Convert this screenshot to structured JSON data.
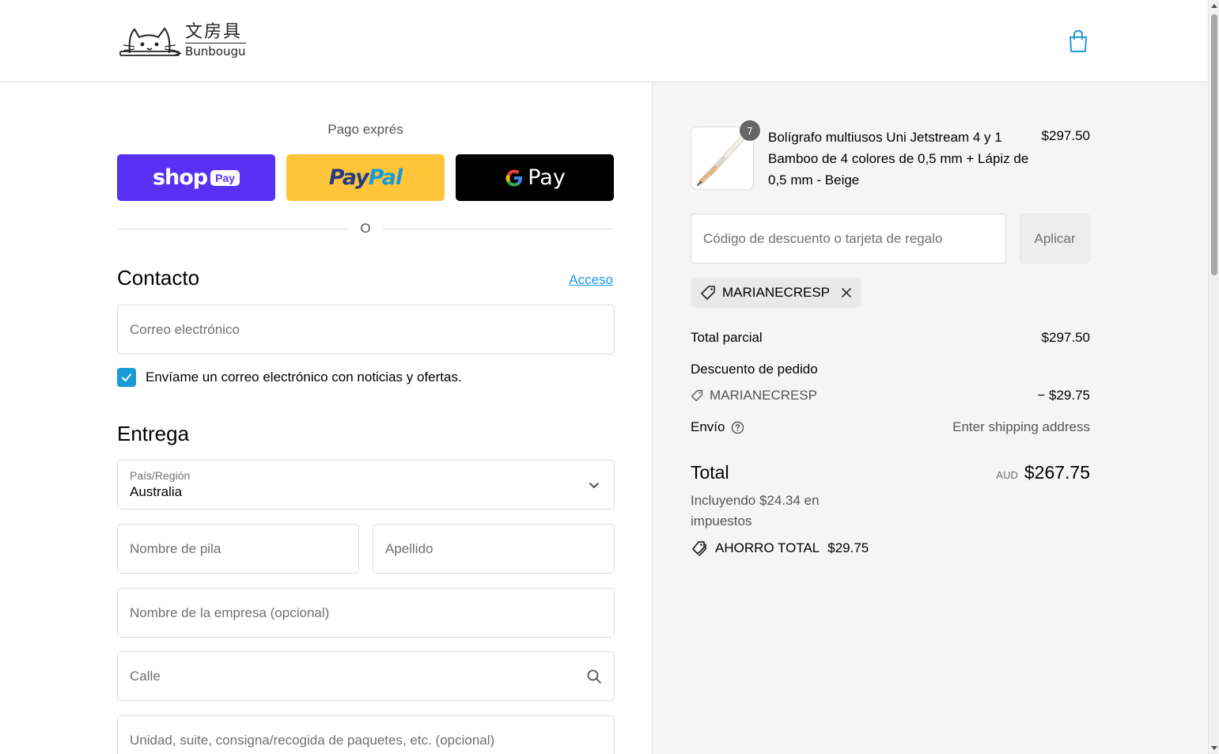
{
  "brand": {
    "kanji": "文房具",
    "name": "Bunbougu"
  },
  "express": {
    "title": "Pago exprés",
    "shop_pay": "shop",
    "shop_pay_pill": "Pay",
    "paypal_a": "Pay",
    "paypal_b": "Pal",
    "gpay": "Pay",
    "or": "O"
  },
  "contact": {
    "title": "Contacto",
    "login": "Acceso",
    "email_placeholder": "Correo electrónico",
    "newsletter": "Envíame un correo electrónico con noticias y ofertas.",
    "newsletter_checked": true
  },
  "delivery": {
    "title": "Entrega",
    "country_label": "País/Región",
    "country_value": "Australia",
    "first_name": "Nombre de pila",
    "last_name": "Apellido",
    "company": "Nombre de la empresa (opcional)",
    "street": "Calle",
    "unit": "Unidad, suite, consigna/recogida de paquetes, etc. (opcional)"
  },
  "order": {
    "product": {
      "name": "Bolígrafo multiusos Uni Jetstream 4 y 1 Bamboo de 4 colores de 0,5 mm + Lápiz de 0,5 mm - Beige",
      "price": "$297.50",
      "quantity": "7"
    },
    "discount_placeholder": "Código de descuento o tarjeta de regalo",
    "apply": "Aplicar",
    "applied_code": "MARIANECRESP",
    "subtotal_label": "Total parcial",
    "subtotal_value": "$297.50",
    "order_discount_label": "Descuento de pedido",
    "discount_code": "MARIANECRESP",
    "discount_value": "− $29.75",
    "shipping_label": "Envío",
    "shipping_value": "Enter shipping address",
    "total_label": "Total",
    "currency": "AUD",
    "total_value": "$267.75",
    "tax_note": "Incluyendo $24.34 en impuestos",
    "savings_label": "AHORRO TOTAL",
    "savings_value": "$29.75"
  },
  "colors": {
    "accent": "#1a9bd7",
    "shop_pay": "#5a31f4",
    "paypal": "#ffc439",
    "gpay": "#000000"
  }
}
